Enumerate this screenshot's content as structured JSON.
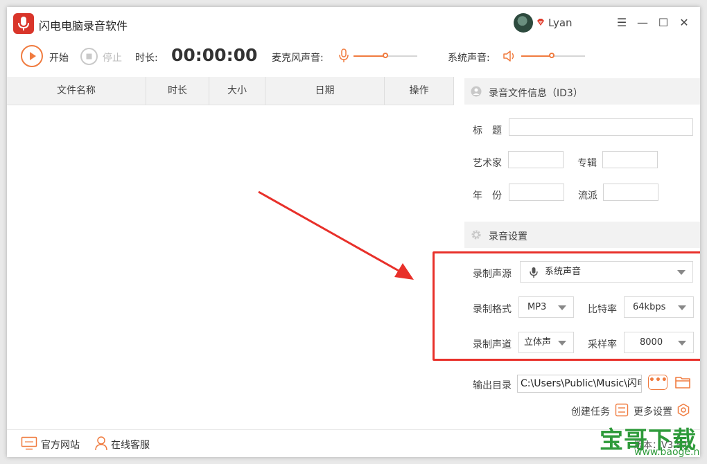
{
  "app": {
    "title": "闪电电脑录音软件",
    "user": "Lyan"
  },
  "window_controls": {
    "menu": "☰",
    "minimize": "—",
    "maximize": "☐",
    "close": "✕"
  },
  "toolbar": {
    "start_label": "开始",
    "stop_label": "停止",
    "duration_label": "时长:",
    "timer": "00:00:00",
    "mic_label": "麦克风声音:",
    "mic_level": 0.5,
    "system_label": "系统声音:",
    "system_level": 0.48
  },
  "table": {
    "columns": [
      "文件名称",
      "时长",
      "大小",
      "日期",
      "操作"
    ],
    "rows": []
  },
  "id3": {
    "title": "录音文件信息（ID3）",
    "labels": {
      "title": "标　题",
      "artist": "艺术家",
      "album": "专辑",
      "year": "年　份",
      "genre": "流派"
    },
    "values": {
      "title": "",
      "artist": "",
      "album": "",
      "year": "",
      "genre": ""
    }
  },
  "settings": {
    "title": "录音设置",
    "source_label": "录制声源",
    "source_value": "系统声音",
    "format_label": "录制格式",
    "format_value": "MP3",
    "bitrate_label": "比特率",
    "bitrate_value": "64kbps",
    "channel_label": "录制声道",
    "channel_value": "立体声",
    "samplerate_label": "采样率",
    "samplerate_value": "8000"
  },
  "output": {
    "label": "输出目录",
    "path": "C:\\Users\\Public\\Music\\闪电",
    "browse": "•••"
  },
  "actions": {
    "create_task": "创建任务",
    "more_settings": "更多设置"
  },
  "footer": {
    "website": "官方网站",
    "support": "在线客服",
    "version": "版本：V3.5.0"
  },
  "watermark": {
    "text": "宝哥下载",
    "url": "www.baoge.net"
  },
  "colors": {
    "accent": "#f07b3f",
    "logo": "#d9352a",
    "highlight": "#e8302a",
    "watermark": "#2e9a3a"
  }
}
